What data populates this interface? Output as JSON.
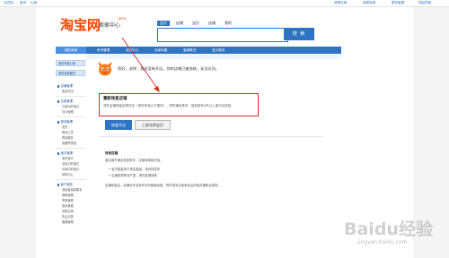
{
  "topbar": {
    "left_links": [
      "站内信",
      "首页",
      "火枪"
    ],
    "right_links": [
      "我是买家",
      "我是卖家",
      "联系客服",
      "网站导航"
    ]
  },
  "logo": {
    "main": "淘宝网",
    "sub": "卖家中心",
    "tag": "BETA"
  },
  "search": {
    "tabs": [
      "宝贝",
      "店铺",
      "宝贝",
      "店铺",
      "我的"
    ],
    "active_tab": 0,
    "value": "",
    "button_label": "搜 索"
  },
  "nav": {
    "home": "我的卖家",
    "items": [
      "帐号管理",
      "消息中心",
      "卖家地图",
      "营销概况",
      "宝贝服务"
    ]
  },
  "sidebar": {
    "top_buttons": [
      "我的商城订单",
      "我的卖家服务"
    ],
    "sections": [
      {
        "title": "店铺管理",
        "items": [
          "免费开店"
        ]
      },
      {
        "title": "交易管理",
        "items": [
          "已卖出的宝贝",
          "评价管理"
        ]
      },
      {
        "title": "物流管理",
        "items": [
          "发货",
          "物流工具",
          "物流服务",
          "我要寄快递"
        ]
      },
      {
        "title": "宝贝管理",
        "items": [
          "发布宝贝",
          "出售中的宝贝",
          "仓库中的宝贝",
          "体检中心"
        ]
      },
      {
        "title": "客户服务",
        "items": [
          "消费者保障服务",
          "退款管理",
          "举报管理",
          "投诉管理",
          "违规记录",
          "售后记录",
          "客服管理"
        ]
      }
    ]
  },
  "notice": {
    "text": "您好，选择：我还没有开店，你的店铺已被冻结，无法访问。"
  },
  "highlight": {
    "title": "重新恢复店铺",
    "desc": "请在店铺恢复后再开店（请先完成以下操作），同时满足条件：保持发布3件以上宝贝后恢复。"
  },
  "buttons": {
    "primary": "恢复开店",
    "secondary": "上架仓库宝贝"
  },
  "tips": {
    "title": "特别提醒",
    "lines": [
      "若店铺不满足恢复条件，店铺将继续冻结：",
      "• 宝贝数量低于规定数量，请尽快发布",
      "• 店铺违规情况严重，请先处理违规",
      "店铺恢复后，如满足开店条件则可继续经营，同时请关注卖家后台的相关通知及规则。"
    ]
  },
  "watermark": {
    "brand": "Baidu经验",
    "url": "jingyan.baidu.com"
  },
  "colors": {
    "accent": "#2f73c4",
    "brand": "#ff4400",
    "highlight_border": "#d52b2b"
  }
}
